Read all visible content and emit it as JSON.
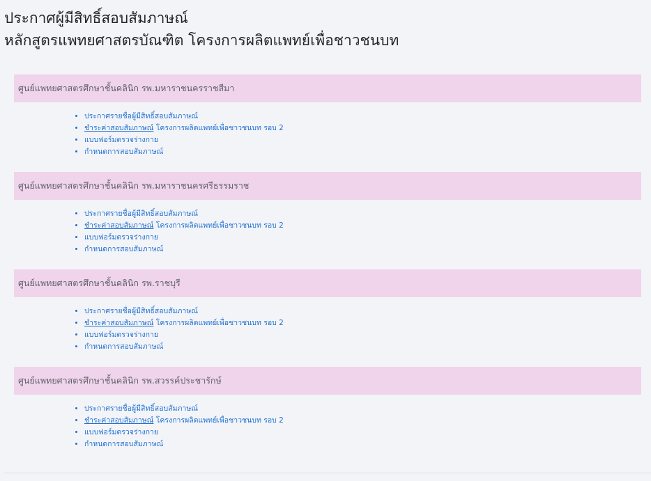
{
  "header": {
    "line1": "ประกาศผู้มีสิทธิ์สอบสัมภาษณ์",
    "line2": "หลักสูตรแพทยศาสตรบัณฑิต โครงการผลิตแพทย์เพื่อชาวชนบท"
  },
  "sections": [
    {
      "title": "ศูนย์แพทยศาสตรศึกษาชั้นคลินิก รพ.มหาราชนครราชสีมา",
      "links": {
        "announce": "ประกาศรายชื่อผู้มีสิทธิ์สอบสัมภาษณ์",
        "pay": "ชำระค่าสอบสัมภาษณ์",
        "pay_suffix": " โครงการผลิตแพทย์เพื่อชาวชนบท รอบ 2",
        "form": "แบบฟอร์มตรวจร่างกาย",
        "schedule": "กำหนดการสอบสัมภาษณ์"
      }
    },
    {
      "title": "ศูนย์แพทยศาสตรศึกษาชั้นคลินิก รพ.มหาราชนครศรีธรรมราช",
      "links": {
        "announce": "ประกาศรายชื่อผู้มีสิทธิ์สอบสัมภาษณ์",
        "pay": "ชำระค่าสอบสัมภาษณ์",
        "pay_suffix": " โครงการผลิตแพทย์เพื่อชาวชนบท รอบ 2",
        "form": "แบบฟอร์มตรวจร่างกาย",
        "schedule": "กำหนดการสอบสัมภาษณ์"
      }
    },
    {
      "title": "ศูนย์แพทยศาสตรศึกษาชั้นคลินิก รพ.ราชบุรี",
      "links": {
        "announce": "ประกาศรายชื่อผู้มีสิทธิ์สอบสัมภาษณ์",
        "pay": "ชำระค่าสอบสัมภาษณ์",
        "pay_suffix": " โครงการผลิตแพทย์เพื่อชาวชนบท รอบ 2",
        "form": "แบบฟอร์มตรวจร่างกาย",
        "schedule": "กำหนดการสอบสัมภาษณ์"
      }
    },
    {
      "title": "ศูนย์แพทยศาสตรศึกษาชั้นคลินิก รพ.สวรรค์ประชารักษ์",
      "links": {
        "announce": "ประกาศรายชื่อผู้มีสิทธิ์สอบสัมภาษณ์",
        "pay": "ชำระค่าสอบสัมภาษณ์",
        "pay_suffix": " โครงการผลิตแพทย์เพื่อชาวชนบท รอบ 2",
        "form": "แบบฟอร์มตรวจร่างกาย",
        "schedule": "กำหนดการสอบสัมภาษณ์"
      }
    }
  ],
  "colors": {
    "background": "#f3f4f8",
    "section_header": "#f0d4ec",
    "link": "#1d6fd1"
  }
}
